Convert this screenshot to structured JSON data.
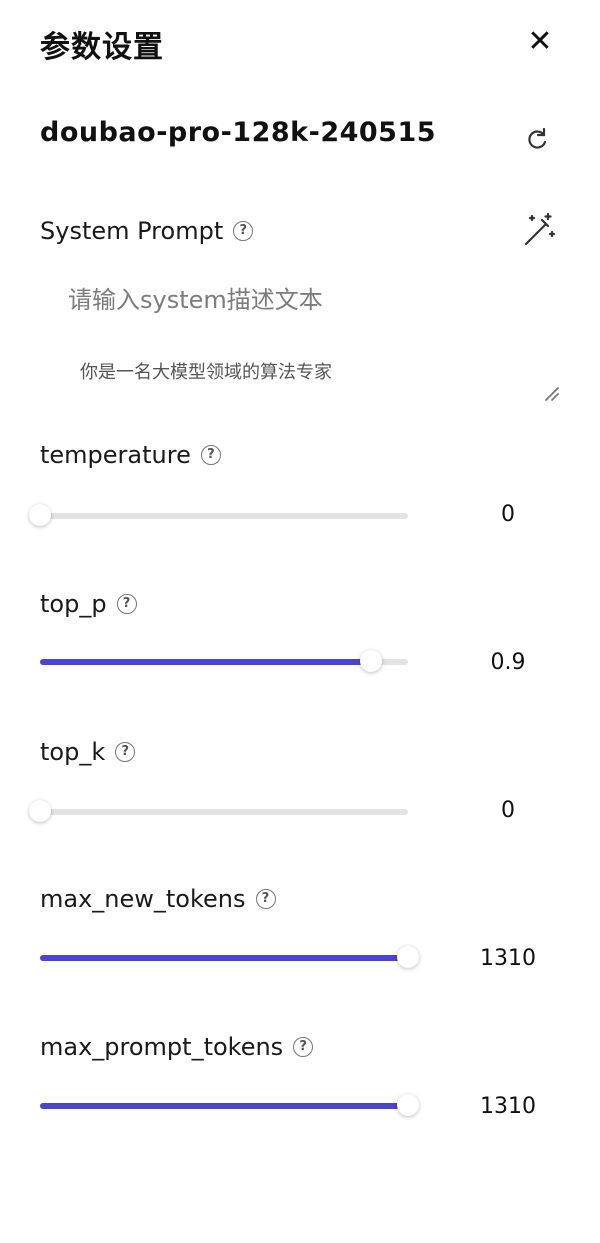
{
  "panel": {
    "title": "参数设置",
    "close_icon": "close-icon"
  },
  "model": {
    "name": "doubao-pro-128k-240515"
  },
  "system_prompt": {
    "label": "System Prompt",
    "placeholder": "请输入system描述文本",
    "value": "你是一名大模型领域的算法专家"
  },
  "sliders": [
    {
      "label": "temperature",
      "value": "0",
      "fraction": 0.0
    },
    {
      "label": "top_p",
      "value": "0.9",
      "fraction": 0.9
    },
    {
      "label": "top_k",
      "value": "0",
      "fraction": 0.0
    },
    {
      "label": "max_new_tokens",
      "value": "1310",
      "fraction": 1.0
    },
    {
      "label": "max_prompt_tokens",
      "value": "1310",
      "fraction": 1.0
    }
  ],
  "colors": {
    "accent": "#4a44cf",
    "track": "#e3e3e3"
  }
}
